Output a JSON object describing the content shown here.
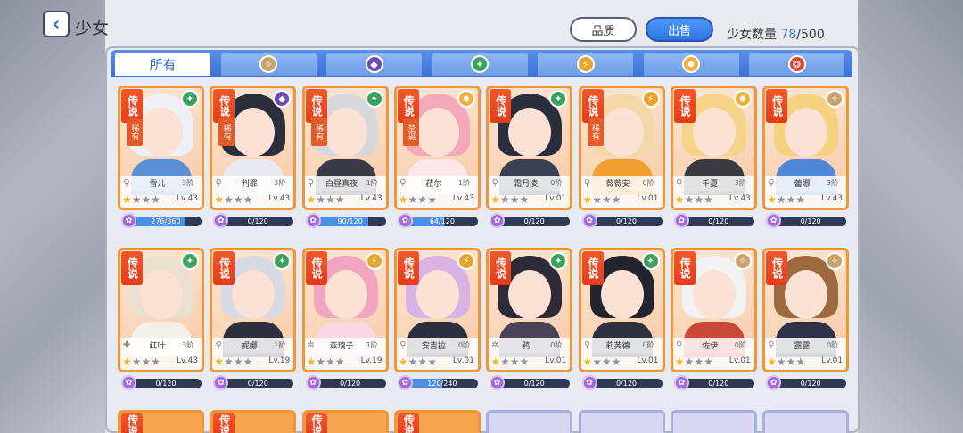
{
  "header": {
    "title": "少女",
    "back_icon": "back-arrow-icon",
    "quality_label": "品质",
    "sell_label": "出售",
    "count_label": "少女数量",
    "count_current": "78",
    "count_max": "/500"
  },
  "tabs": [
    {
      "label": "所有",
      "icon": "",
      "color": ""
    },
    {
      "label": "",
      "icon": "light-element-icon",
      "color": "#c9a46a"
    },
    {
      "label": "",
      "icon": "dark-element-icon",
      "color": "#6b4bb5"
    },
    {
      "label": "",
      "icon": "wind-element-icon",
      "color": "#3ca35f"
    },
    {
      "label": "",
      "icon": "thunder-element-icon",
      "color": "#e8a52b"
    },
    {
      "label": "",
      "icon": "sun-element-icon",
      "color": "#f0b040"
    },
    {
      "label": "",
      "icon": "fire-element-icon",
      "color": "#d84530"
    }
  ],
  "cards": [
    {
      "rank": "传说",
      "rare": "稀有",
      "name": "雪儿",
      "stage": "3阶",
      "cls": "⚲",
      "stars": 1,
      "lv": "Lv.43",
      "exp": "276/360",
      "fill": 0.77,
      "elem": "wind",
      "hair": "#eef0f5",
      "cloth": "#5a8fd6"
    },
    {
      "rank": "传说",
      "rare": "稀有",
      "name": "判罪",
      "stage": "3阶",
      "cls": "⚲",
      "stars": 1,
      "lv": "Lv.43",
      "exp": "0/120",
      "fill": 0,
      "elem": "dark",
      "hair": "#2b2f3c",
      "cloth": "#e8eaf0"
    },
    {
      "rank": "传说",
      "rare": "稀有",
      "name": "白昼真夜",
      "stage": "1阶",
      "cls": "⚲",
      "stars": 1,
      "lv": "Lv.43",
      "exp": "90/120",
      "fill": 0.75,
      "elem": "wind",
      "hair": "#d8d8dc",
      "cloth": "#3a3a46"
    },
    {
      "rank": "传说",
      "rare": "圣诞",
      "name": "菈尔",
      "stage": "1阶",
      "cls": "⚲",
      "stars": 1,
      "lv": "Lv.43",
      "exp": "64/120",
      "fill": 0.53,
      "elem": "sun",
      "hair": "#f3a9b9",
      "cloth": "#fbe7ea"
    },
    {
      "rank": "传说",
      "rare": "",
      "name": "霜月凌",
      "stage": "0阶",
      "cls": "⚲",
      "stars": 1,
      "lv": "Lv.01",
      "exp": "0/120",
      "fill": 0,
      "elem": "wind",
      "hair": "#2a2e3c",
      "cloth": "#3b3f52"
    },
    {
      "rank": "传说",
      "rare": "稀有",
      "name": "薇薇安",
      "stage": "0阶",
      "cls": "⚲",
      "stars": 1,
      "lv": "Lv.01",
      "exp": "0/120",
      "fill": 0,
      "elem": "thunder",
      "hair": "#f4d8a8",
      "cloth": "#f0a030"
    },
    {
      "rank": "传说",
      "rare": "",
      "name": "千夏",
      "stage": "3阶",
      "cls": "⚲",
      "stars": 1,
      "lv": "Lv.43",
      "exp": "0/120",
      "fill": 0,
      "elem": "sun",
      "hair": "#f5d48a",
      "cloth": "#3a3a40"
    },
    {
      "rank": "传说",
      "rare": "",
      "name": "蕾娜",
      "stage": "3阶",
      "cls": "⚲",
      "stars": 1,
      "lv": "Lv.43",
      "exp": "0/120",
      "fill": 0,
      "elem": "light",
      "hair": "#f4d27e",
      "cloth": "#4f86d6"
    },
    {
      "rank": "传说",
      "rare": "",
      "name": "红叶",
      "stage": "3阶",
      "cls": "✚",
      "stars": 1,
      "lv": "Lv.43",
      "exp": "0/120",
      "fill": 0,
      "elem": "wind",
      "hair": "#e9e0cf",
      "cloth": "#f3f0ea"
    },
    {
      "rank": "传说",
      "rare": "",
      "name": "妮娜",
      "stage": "1阶",
      "cls": "⚲",
      "stars": 1,
      "lv": "Lv.19",
      "exp": "0/120",
      "fill": 0,
      "elem": "wind",
      "hair": "#d7dae2",
      "cloth": "#2b2f3e"
    },
    {
      "rank": "传说",
      "rare": "",
      "name": "亚璃子",
      "stage": "1阶",
      "cls": "✲",
      "stars": 1,
      "lv": "Lv.19",
      "exp": "0/120",
      "fill": 0,
      "elem": "thunder",
      "hair": "#f2a5c0",
      "cloth": "#f9d7e3"
    },
    {
      "rank": "传说",
      "rare": "",
      "name": "安吉拉",
      "stage": "0阶",
      "cls": "⚲",
      "stars": 1,
      "lv": "Lv.01",
      "exp": "120/240",
      "fill": 0.5,
      "elem": "thunder",
      "hair": "#d9b3e6",
      "cloth": "#2a3040"
    },
    {
      "rank": "传说",
      "rare": "",
      "name": "鸦",
      "stage": "0阶",
      "cls": "✲",
      "stars": 1,
      "lv": "Lv.01",
      "exp": "0/120",
      "fill": 0,
      "elem": "wind",
      "hair": "#2e2a3a",
      "cloth": "#4a4258"
    },
    {
      "rank": "传说",
      "rare": "",
      "name": "莉芙德",
      "stage": "0阶",
      "cls": "⚲",
      "stars": 1,
      "lv": "Lv.01",
      "exp": "0/120",
      "fill": 0,
      "elem": "wind",
      "hair": "#222530",
      "cloth": "#2d3140"
    },
    {
      "rank": "传说",
      "rare": "",
      "name": "佐伊",
      "stage": "0阶",
      "cls": "⚲",
      "stars": 1,
      "lv": "Lv.01",
      "exp": "0/120",
      "fill": 0,
      "elem": "light",
      "hair": "#f2f2f4",
      "cloth": "#c9483a"
    },
    {
      "rank": "传说",
      "rare": "",
      "name": "露露",
      "stage": "0阶",
      "cls": "⚲",
      "stars": 1,
      "lv": "Lv.01",
      "exp": "0/120",
      "fill": 0,
      "elem": "light",
      "hair": "#9c6a3e",
      "cloth": "#2f3246"
    }
  ],
  "partial_cards": [
    {
      "label": "传说",
      "style": "orange"
    },
    {
      "label": "传说",
      "style": "orange"
    },
    {
      "label": "传说",
      "style": "orange"
    },
    {
      "label": "传说",
      "style": "orange"
    },
    {
      "label": "",
      "style": "blue"
    },
    {
      "label": "",
      "style": "blue"
    },
    {
      "label": "",
      "style": "blue"
    },
    {
      "label": "",
      "style": "blue"
    }
  ],
  "elements": {
    "wind": {
      "color": "#3ca35f",
      "glyph": "✦"
    },
    "dark": {
      "color": "#6b4bb5",
      "glyph": "◆"
    },
    "sun": {
      "color": "#f0b040",
      "glyph": "✹"
    },
    "thunder": {
      "color": "#e8a52b",
      "glyph": "⚡"
    },
    "light": {
      "color": "#c9a46a",
      "glyph": "✧"
    }
  }
}
